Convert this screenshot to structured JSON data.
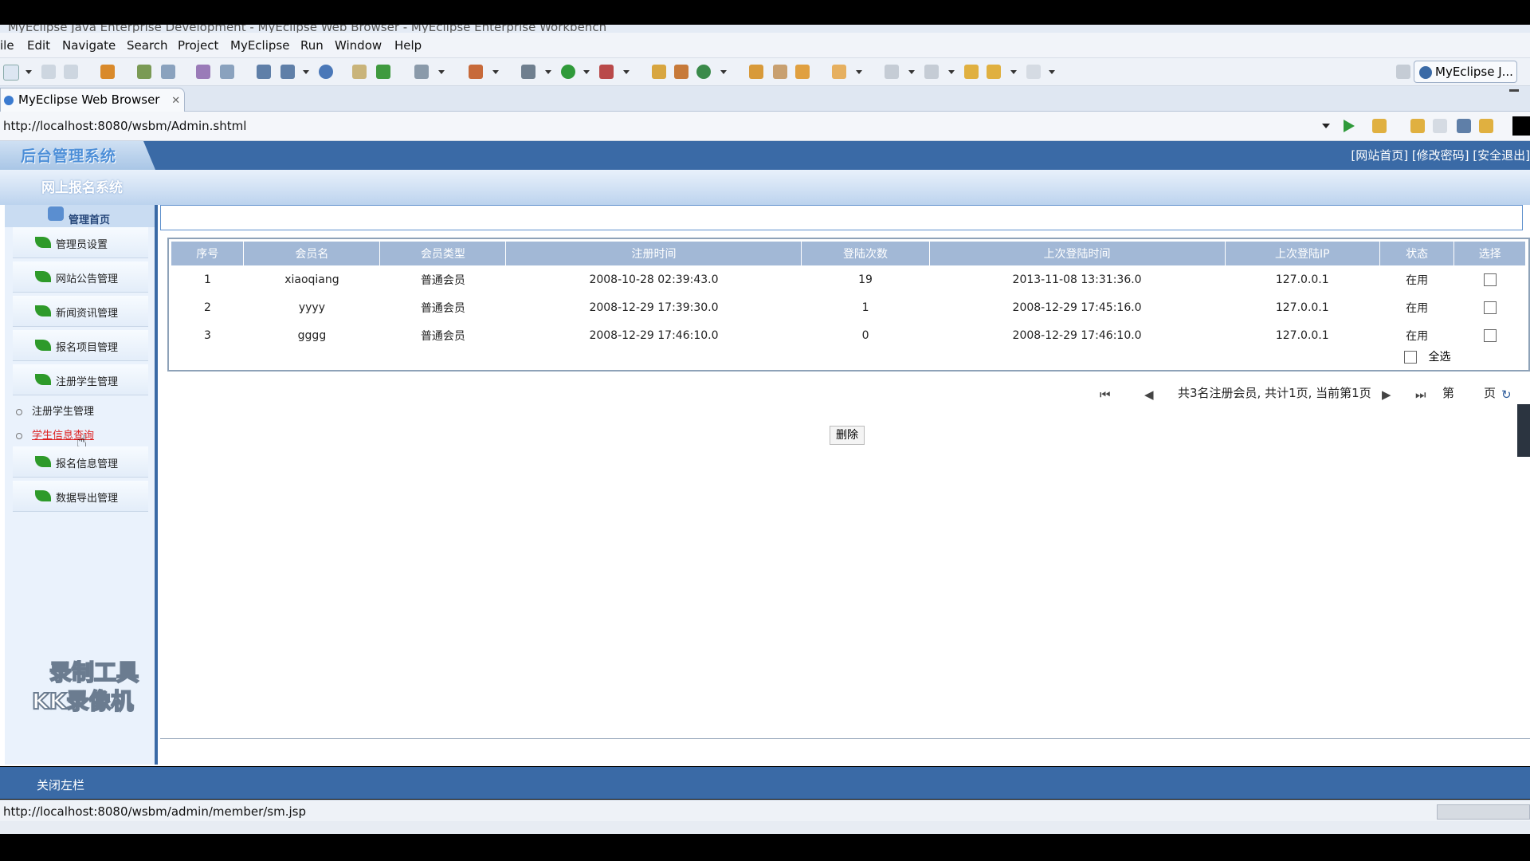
{
  "window": {
    "title": "MyEclipse Java Enterprise Development - MyEclipse Web Browser - MyEclipse Enterprise Workbench"
  },
  "menu": [
    "ile",
    "Edit",
    "Navigate",
    "Search",
    "Project",
    "MyEclipse",
    "Run",
    "Window",
    "Help"
  ],
  "perspective_label": "MyEclipse J...",
  "tab": {
    "label": "MyEclipse Web Browser"
  },
  "address": {
    "url": "http://localhost:8080/wsbm/Admin.shtml"
  },
  "site": {
    "logo": "后台管理系统",
    "subtitle": "网上报名系统",
    "top_links": "[网站首页] [修改密码] [安全退出]"
  },
  "sidebar": {
    "home": "管理首页",
    "items": [
      {
        "label": "管理员设置"
      },
      {
        "label": "网站公告管理"
      },
      {
        "label": "新闻资讯管理"
      },
      {
        "label": "报名项目管理"
      },
      {
        "label": "注册学生管理"
      }
    ],
    "subitems": [
      {
        "label": "注册学生管理"
      },
      {
        "label": "学生信息查询"
      }
    ],
    "items_after": [
      {
        "label": "报名信息管理"
      },
      {
        "label": "数据导出管理"
      }
    ],
    "watermark_line1": "录制工具",
    "watermark_line2": "KK录像机"
  },
  "table": {
    "headers": [
      "序号",
      "会员名",
      "会员类型",
      "注册时间",
      "登陆次数",
      "上次登陆时间",
      "上次登陆IP",
      "状态",
      "选择"
    ],
    "rows": [
      [
        "1",
        "xiaoqiang",
        "普通会员",
        "2008-10-28 02:39:43.0",
        "19",
        "2013-11-08 13:31:36.0",
        "127.0.0.1",
        "在用"
      ],
      [
        "2",
        "yyyy",
        "普通会员",
        "2008-12-29 17:39:30.0",
        "1",
        "2008-12-29 17:45:16.0",
        "127.0.0.1",
        "在用"
      ],
      [
        "3",
        "gggg",
        "普通会员",
        "2008-12-29 17:46:10.0",
        "0",
        "2008-12-29 17:46:10.0",
        "127.0.0.1",
        "在用"
      ]
    ],
    "select_all": "全选"
  },
  "pager": {
    "summary": "共3名注册会员, 共计1页, 当前第1页",
    "page_prefix": "第",
    "page_suffix": "页"
  },
  "delete_label": "删除",
  "footer": {
    "close_left": "关闭左栏"
  },
  "statusbar": {
    "url": "http://localhost:8080/wsbm/admin/member/sm.jsp"
  },
  "colors": {
    "header_blue": "#3a6aa6",
    "table_header": "#a2b8d6",
    "status_link": "#1a3fb3"
  }
}
